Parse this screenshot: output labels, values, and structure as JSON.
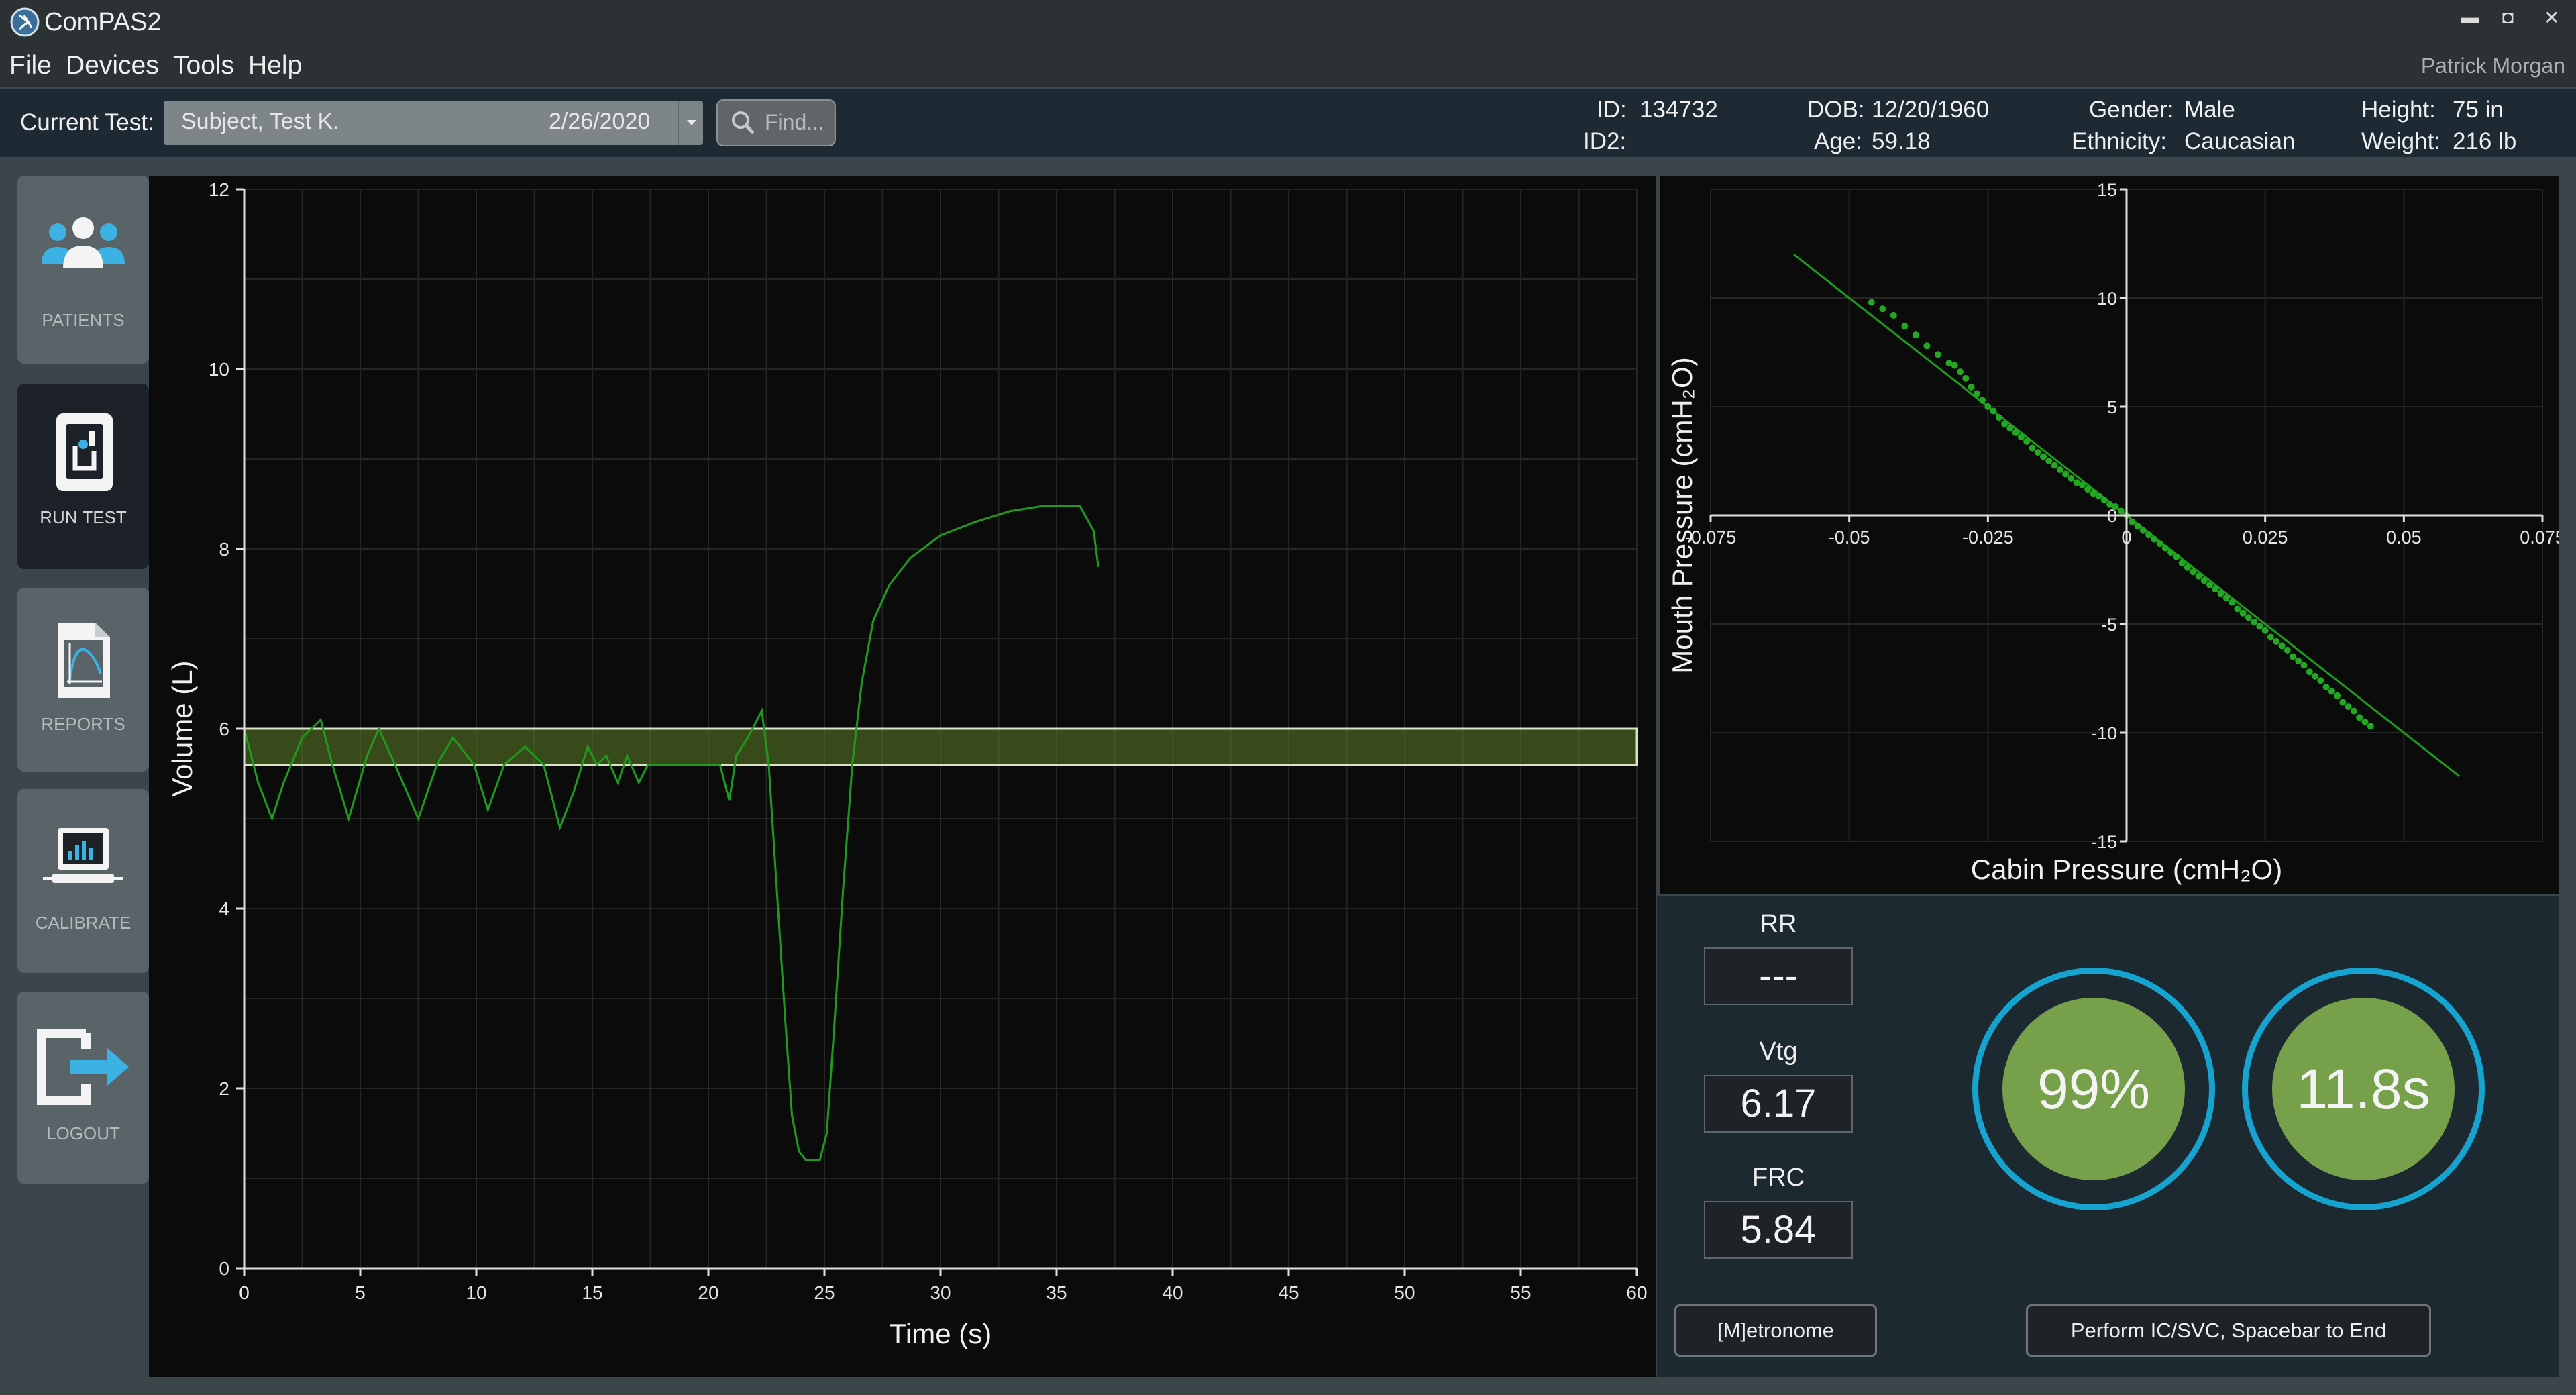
{
  "app": {
    "title": "ComPAS2",
    "user": "Patrick Morgan"
  },
  "window_controls": {
    "minimize": "▬",
    "maximize": "◘",
    "close": "✕"
  },
  "menu": [
    "File",
    "Devices",
    "Tools",
    "Help"
  ],
  "test": {
    "label": "Current Test:",
    "subject": "Subject, Test K.",
    "date": "2/26/2020",
    "find_placeholder": "Find..."
  },
  "patient": {
    "id_label": "ID:",
    "id": "134732",
    "id2_label": "ID2:",
    "id2": "",
    "dob_label": "DOB:",
    "dob": "12/20/1960",
    "age_label": "Age:",
    "age": "59.18",
    "gender_label": "Gender:",
    "gender": "Male",
    "ethnicity_label": "Ethnicity:",
    "ethnicity": "Caucasian",
    "height_label": "Height:",
    "height": "75 in",
    "weight_label": "Weight:",
    "weight": "216 lb"
  },
  "nav": [
    {
      "label": "PATIENTS",
      "icon": "patients-icon"
    },
    {
      "label": "RUN TEST",
      "icon": "run-test-icon",
      "active": true
    },
    {
      "label": "REPORTS",
      "icon": "reports-icon"
    },
    {
      "label": "CALIBRATE",
      "icon": "calibrate-icon"
    },
    {
      "label": "LOGOUT",
      "icon": "logout-icon"
    }
  ],
  "params": {
    "rr_label": "RR",
    "rr": "---",
    "vtg_label": "Vtg",
    "vtg": "6.17",
    "frc_label": "FRC",
    "frc": "5.84"
  },
  "indicators": {
    "percent": "99%",
    "time": "11.8s"
  },
  "buttons": {
    "metronome": "[M]etronome",
    "perform": "Perform IC/SVC, Spacebar to End"
  },
  "colors": {
    "trace": "#1f9a1f",
    "band": "#6b8a2a",
    "indicator": "#76a04a",
    "ring": "#16a3d0"
  },
  "chart_data": [
    {
      "type": "line",
      "xlabel": "Time (s)",
      "ylabel": "Volume (L)",
      "xlim": [
        0,
        60
      ],
      "ylim": [
        0,
        12
      ],
      "xticks": [
        0,
        5,
        10,
        15,
        20,
        25,
        30,
        35,
        40,
        45,
        50,
        55,
        60
      ],
      "yticks": [
        0,
        2,
        4,
        6,
        8,
        10,
        12
      ],
      "grid": true,
      "band": [
        5.6,
        6.0
      ],
      "series": [
        {
          "x": [
            0,
            0.6,
            1.2,
            1.7,
            2.5,
            3.3,
            3.8,
            4.5,
            5.3,
            5.8,
            6.5,
            7.5,
            8.3,
            9.0,
            9.9,
            10.5,
            11.2,
            12.1,
            12.9,
            13.6,
            14.2,
            14.8,
            15.2,
            15.6,
            16.1,
            16.5,
            17.0,
            17.4,
            18.2,
            19.5,
            20.5,
            20.9,
            21.2,
            21.7,
            22.3,
            22.6,
            22.9,
            23.3,
            23.6,
            23.9,
            24.2,
            24.8,
            25.1,
            25.4,
            25.8,
            26.2,
            26.6,
            27.1,
            27.8,
            28.7,
            30.0,
            31.5,
            33.0,
            34.5,
            36.0,
            36.6,
            36.8
          ],
          "y": [
            6.0,
            5.4,
            5.0,
            5.4,
            5.9,
            6.1,
            5.6,
            5.0,
            5.7,
            6.0,
            5.6,
            5.0,
            5.6,
            5.9,
            5.6,
            5.1,
            5.6,
            5.8,
            5.6,
            4.9,
            5.3,
            5.8,
            5.6,
            5.7,
            5.4,
            5.7,
            5.4,
            5.6,
            5.6,
            5.6,
            5.6,
            5.2,
            5.7,
            5.9,
            6.2,
            5.6,
            4.4,
            2.8,
            1.7,
            1.3,
            1.2,
            1.2,
            1.5,
            2.6,
            4.2,
            5.6,
            6.5,
            7.2,
            7.6,
            7.9,
            8.15,
            8.3,
            8.42,
            8.48,
            8.48,
            8.2,
            7.8
          ]
        }
      ]
    },
    {
      "type": "scatter",
      "xlabel": "Cabin Pressure (cmH₂O)",
      "ylabel": "Mouth Pressure (cmH₂O)",
      "xlim": [
        -0.075,
        0.075
      ],
      "ylim": [
        -15,
        15
      ],
      "xticks": [
        -0.075,
        -0.05,
        -0.025,
        0,
        0.025,
        0.05,
        0.075
      ],
      "xtick_labels": [
        "-0.075",
        "-0.05",
        "-0.025",
        "0",
        "0.025",
        "0.05",
        "0.075"
      ],
      "yticks": [
        -15,
        -10,
        -5,
        0,
        5,
        10,
        15
      ],
      "grid": true,
      "fit_line": {
        "x": [
          -0.06,
          0.06
        ],
        "y": [
          12.0,
          -12.0
        ]
      },
      "series": [
        {
          "x": [
            -0.046,
            -0.044,
            -0.042,
            -0.04,
            -0.038,
            -0.036,
            -0.034,
            -0.032,
            -0.031,
            -0.03,
            -0.029,
            -0.028,
            -0.027,
            -0.026,
            -0.025,
            -0.024,
            -0.023,
            -0.022,
            -0.021,
            -0.02,
            -0.019,
            -0.018,
            -0.017,
            -0.016,
            -0.015,
            -0.014,
            -0.013,
            -0.012,
            -0.011,
            -0.01,
            -0.009,
            -0.008,
            -0.007,
            -0.006,
            -0.005,
            -0.004,
            -0.003,
            -0.002,
            -0.001,
            0.0,
            0.001,
            0.002,
            0.003,
            0.004,
            0.005,
            0.006,
            0.007,
            0.008,
            0.009,
            0.01,
            0.011,
            0.012,
            0.013,
            0.014,
            0.015,
            0.016,
            0.017,
            0.018,
            0.019,
            0.02,
            0.021,
            0.022,
            0.023,
            0.024,
            0.025,
            0.026,
            0.027,
            0.028,
            0.029,
            0.03,
            0.031,
            0.032,
            0.033,
            0.034,
            0.035,
            0.036,
            0.037,
            0.038,
            0.039,
            0.04,
            0.041,
            0.042,
            0.043,
            0.044
          ],
          "y": [
            9.8,
            9.5,
            9.2,
            8.7,
            8.3,
            7.8,
            7.4,
            7.0,
            6.9,
            6.6,
            6.3,
            5.9,
            5.6,
            5.3,
            5.0,
            4.8,
            4.5,
            4.2,
            4.0,
            3.8,
            3.6,
            3.4,
            3.1,
            2.9,
            2.7,
            2.5,
            2.3,
            2.1,
            1.9,
            1.7,
            1.5,
            1.4,
            1.2,
            1.0,
            0.9,
            0.7,
            0.5,
            0.4,
            0.2,
            0.0,
            -0.3,
            -0.5,
            -0.7,
            -0.9,
            -1.1,
            -1.3,
            -1.5,
            -1.7,
            -1.9,
            -2.2,
            -2.4,
            -2.6,
            -2.8,
            -3.0,
            -3.2,
            -3.4,
            -3.6,
            -3.8,
            -4.0,
            -4.3,
            -4.5,
            -4.7,
            -4.9,
            -5.1,
            -5.3,
            -5.6,
            -5.8,
            -6.0,
            -6.2,
            -6.5,
            -6.7,
            -6.9,
            -7.2,
            -7.4,
            -7.6,
            -7.9,
            -8.1,
            -8.3,
            -8.6,
            -8.8,
            -9.0,
            -9.3,
            -9.5,
            -9.7
          ]
        }
      ]
    }
  ]
}
